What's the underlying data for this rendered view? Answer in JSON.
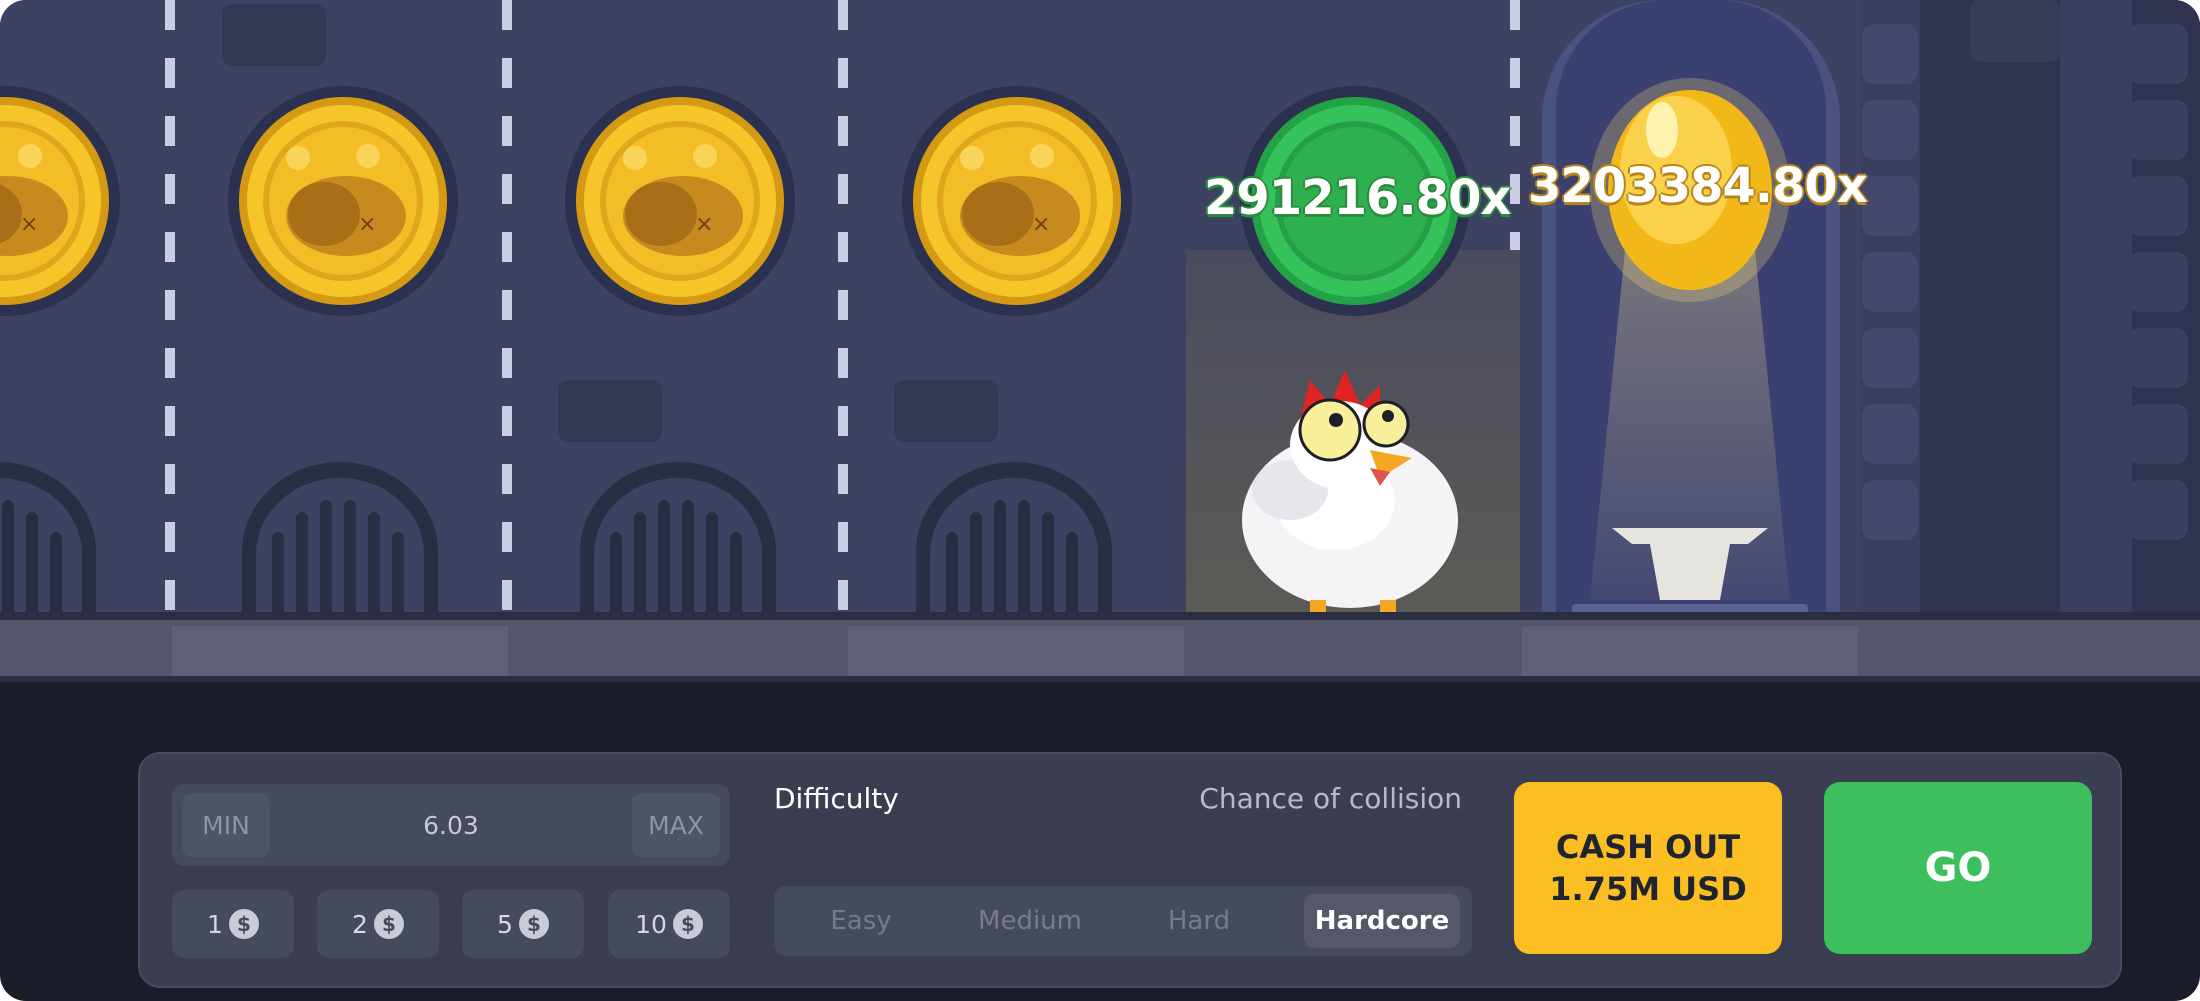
{
  "game": {
    "multipliers": {
      "current": "291216.80x",
      "final": "3203384.80x"
    },
    "lanes": [
      {
        "state": "passed",
        "icon": "roast-chicken-icon"
      },
      {
        "state": "passed",
        "icon": "roast-chicken-icon"
      },
      {
        "state": "passed",
        "icon": "roast-chicken-icon"
      },
      {
        "state": "passed",
        "icon": "roast-chicken-icon"
      },
      {
        "state": "current",
        "icon": "green-coin-icon"
      },
      {
        "state": "goal",
        "icon": "golden-egg-icon"
      }
    ],
    "colors": {
      "background": "#3d4263",
      "coin_gold": "#fbbf24",
      "coin_green": "#2fae4e",
      "panel": "#3a3e50",
      "cashout": "#fbbf24",
      "go": "#3cbf5c"
    }
  },
  "controls": {
    "bet": {
      "min_label": "MIN",
      "max_label": "MAX",
      "value": "6.03"
    },
    "quick_bets": [
      {
        "label": "1",
        "icon": "dollar-coin-icon"
      },
      {
        "label": "2",
        "icon": "dollar-coin-icon"
      },
      {
        "label": "5",
        "icon": "dollar-coin-icon"
      },
      {
        "label": "10",
        "icon": "dollar-coin-icon"
      }
    ],
    "difficulty": {
      "label": "Difficulty",
      "collision_label": "Chance of collision",
      "options": [
        "Easy",
        "Medium",
        "Hard",
        "Hardcore"
      ],
      "selected": "Hardcore"
    },
    "cashout": {
      "line1": "CASH OUT",
      "line2": "1.75M USD"
    },
    "go_label": "GO"
  }
}
